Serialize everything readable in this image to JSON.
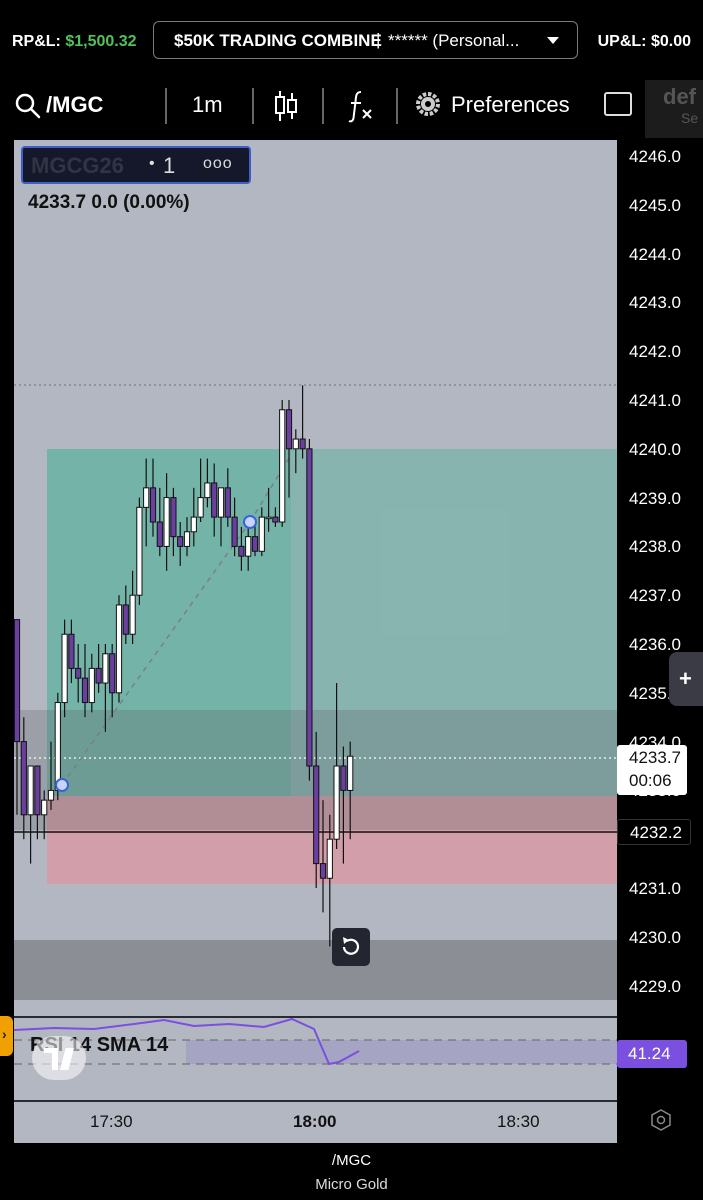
{
  "header": {
    "rpl_label": "RP&L:",
    "rpl_value": "$1,500.32",
    "account_title": "$50K TRADING COMBINE",
    "account_sep": "|",
    "account_name": "****** (Personal...",
    "upl_label": "UP&L:",
    "upl_value": "$0.00"
  },
  "toolbar": {
    "symbol": "/MGC",
    "timeframe": "1m",
    "preferences": "Preferences",
    "extra_line1": "def",
    "extra_line2": "Se"
  },
  "legend": {
    "contract": "MGCG26",
    "dot": "•",
    "interval": "1",
    "more": "ooo",
    "quote": "4233.7  0.0 (0.00%)"
  },
  "price_axis": {
    "ticks": [
      "4246.0",
      "4245.0",
      "4244.0",
      "4243.0",
      "4242.0",
      "4241.0",
      "4240.0",
      "4239.0",
      "4238.0",
      "4237.0",
      "4236.0",
      "4235.0",
      "4234.0",
      "4233.0",
      "4232.0",
      "4231.0",
      "4230.0",
      "4229.0"
    ],
    "last_price": "4233.7",
    "countdown": "00:06",
    "line_price": "4232.2",
    "plus": "+"
  },
  "time_axis": {
    "labels": [
      "17:30",
      "18:00",
      "18:30"
    ]
  },
  "rsi": {
    "label": "RSI 14 SMA 14",
    "value": "41.24"
  },
  "footer": {
    "line1": "/MGC",
    "line2": "Micro Gold"
  },
  "colors": {
    "chart_bg": "#b3b7c1",
    "profit_zone": "#64b3a2",
    "loss_zone": "#d5939e",
    "bull_candle": "#ffffff",
    "bear_candle": "#6b3fa0",
    "rsi_line": "#7b4fe0",
    "rpl_positive": "#4fc259"
  },
  "chart_data": {
    "type": "candlestick",
    "ylim": [
      4228.5,
      4246.4
    ],
    "x_ticks": [
      "17:30",
      "18:00",
      "18:30"
    ],
    "series": [
      {
        "values": [
          [
            4236.5,
            4236.5,
            4232.5,
            4234.0
          ],
          [
            4234.0,
            4234.5,
            4232.0,
            4232.5
          ],
          [
            4232.5,
            4233.5,
            4231.5,
            4233.5
          ],
          [
            4233.5,
            4233.5,
            4232.0,
            4232.5
          ],
          [
            4232.5,
            4233.0,
            4232.0,
            4232.8
          ],
          [
            4232.8,
            4234.0,
            4232.6,
            4233.0
          ],
          [
            4233.0,
            4235.0,
            4232.8,
            4234.8
          ],
          [
            4234.8,
            4236.5,
            4234.5,
            4236.2
          ],
          [
            4236.2,
            4236.5,
            4235.2,
            4235.5
          ],
          [
            4235.5,
            4236.0,
            4234.8,
            4235.3
          ],
          [
            4235.3,
            4236.0,
            4234.5,
            4234.8
          ],
          [
            4234.8,
            4235.8,
            4234.6,
            4235.5
          ],
          [
            4235.5,
            4236.0,
            4235.0,
            4235.2
          ],
          [
            4235.2,
            4236.0,
            4234.2,
            4235.8
          ],
          [
            4235.8,
            4236.0,
            4234.5,
            4235.0
          ],
          [
            4235.0,
            4237.0,
            4234.8,
            4236.8
          ],
          [
            4236.8,
            4237.2,
            4236.0,
            4236.2
          ],
          [
            4236.2,
            4237.5,
            4236.0,
            4237.0
          ],
          [
            4237.0,
            4239.0,
            4236.8,
            4238.8
          ],
          [
            4238.8,
            4239.8,
            4238.0,
            4239.2
          ],
          [
            4239.2,
            4239.8,
            4238.2,
            4238.5
          ],
          [
            4238.5,
            4239.2,
            4237.8,
            4238.0
          ],
          [
            4238.0,
            4239.5,
            4237.5,
            4239.0
          ],
          [
            4239.0,
            4239.2,
            4237.8,
            4238.2
          ],
          [
            4238.2,
            4238.5,
            4237.6,
            4238.0
          ],
          [
            4238.0,
            4238.6,
            4237.8,
            4238.3
          ],
          [
            4238.3,
            4239.2,
            4238.0,
            4238.6
          ],
          [
            4238.6,
            4239.8,
            4238.5,
            4239.0
          ],
          [
            4239.0,
            4239.8,
            4238.8,
            4239.3
          ],
          [
            4239.3,
            4239.7,
            4238.2,
            4238.6
          ],
          [
            4238.6,
            4239.2,
            4238.0,
            4239.2
          ],
          [
            4239.2,
            4239.6,
            4238.4,
            4238.6
          ],
          [
            4238.6,
            4239.0,
            4237.8,
            4238.0
          ],
          [
            4238.0,
            4238.4,
            4237.5,
            4237.8
          ],
          [
            4237.8,
            4238.5,
            4237.5,
            4238.2
          ],
          [
            4238.2,
            4238.5,
            4237.8,
            4237.9
          ],
          [
            4237.9,
            4238.8,
            4237.8,
            4238.6
          ],
          [
            4238.6,
            4239.2,
            4238.3,
            4238.6
          ],
          [
            4238.6,
            4238.8,
            4238.4,
            4238.5
          ],
          [
            4238.5,
            4241.0,
            4238.4,
            4240.8
          ],
          [
            4240.8,
            4241.0,
            4239.0,
            4240.0
          ],
          [
            4240.0,
            4240.4,
            4239.5,
            4240.2
          ],
          [
            4240.2,
            4241.3,
            4239.8,
            4240.0
          ],
          [
            4240.0,
            4240.2,
            4233.2,
            4233.5
          ],
          [
            4233.5,
            4234.2,
            4231.0,
            4231.5
          ],
          [
            4231.5,
            4232.8,
            4230.5,
            4231.2
          ],
          [
            4231.2,
            4232.5,
            4229.8,
            4232.0
          ],
          [
            4232.0,
            4235.2,
            4231.8,
            4233.5
          ],
          [
            4233.5,
            4233.9,
            4231.5,
            4233.0
          ],
          [
            4233.0,
            4234.0,
            4232.0,
            4233.7
          ]
        ]
      }
    ]
  }
}
